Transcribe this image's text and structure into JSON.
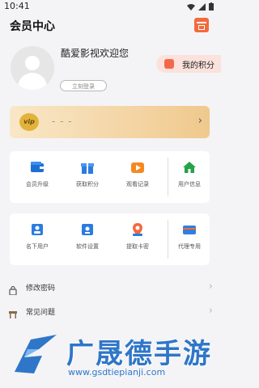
{
  "status_bar": {
    "time": "10:41"
  },
  "header": {
    "title": "会员中心",
    "gift_icon": "gift-icon"
  },
  "profile": {
    "welcome": "酷爱影视欢迎您",
    "login_button": "立刻登录",
    "points_label": "我的积分"
  },
  "vip": {
    "badge": "vip",
    "placeholder": "- - -"
  },
  "grid1": [
    {
      "label": "会员升级",
      "icon": "wallet-icon",
      "color": "#1f6fd1"
    },
    {
      "label": "获取积分",
      "icon": "gift-box-icon",
      "color": "#2b7be0"
    },
    {
      "label": "观看记录",
      "icon": "play-record-icon",
      "color": "#f5891f"
    },
    {
      "label": "用户信息",
      "icon": "home-icon",
      "color": "#27a24a"
    }
  ],
  "grid2": [
    {
      "label": "名下用户",
      "icon": "users-icon",
      "color": "#2b7be0"
    },
    {
      "label": "软件设置",
      "icon": "settings-icon",
      "color": "#2b7be0"
    },
    {
      "label": "提取卡密",
      "icon": "location-icon",
      "color": "#f36a3c"
    },
    {
      "label": "代理专用",
      "icon": "card-icon",
      "color": "#2f7fe0"
    }
  ],
  "menu": [
    {
      "label": "修改密码",
      "icon": "lock-icon"
    },
    {
      "label": "常见问题",
      "icon": "desk-icon"
    }
  ],
  "watermark": {
    "text": "广晟德手游",
    "url": "www.gsdtiepianji.com"
  }
}
